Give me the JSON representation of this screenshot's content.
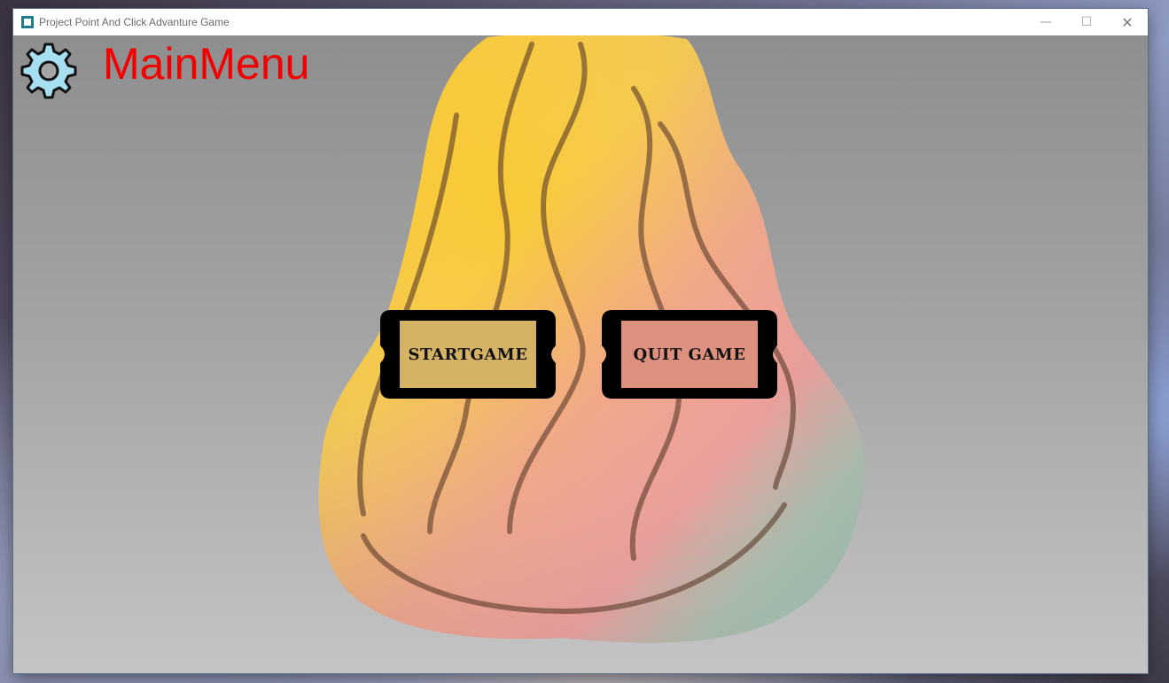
{
  "window": {
    "title": "Project Point And Click Advanture Game",
    "controls": {
      "minimize": "—",
      "maximize": "☐",
      "close": "✕"
    }
  },
  "menu": {
    "title": "MainMenu",
    "settings_icon": "gear-icon",
    "buttons": {
      "start": "STARTGAME",
      "quit": "QUIT GAME"
    }
  },
  "colors": {
    "title": "#f20000",
    "gear_fill": "#a8dff0",
    "button_frame": "#000000"
  }
}
